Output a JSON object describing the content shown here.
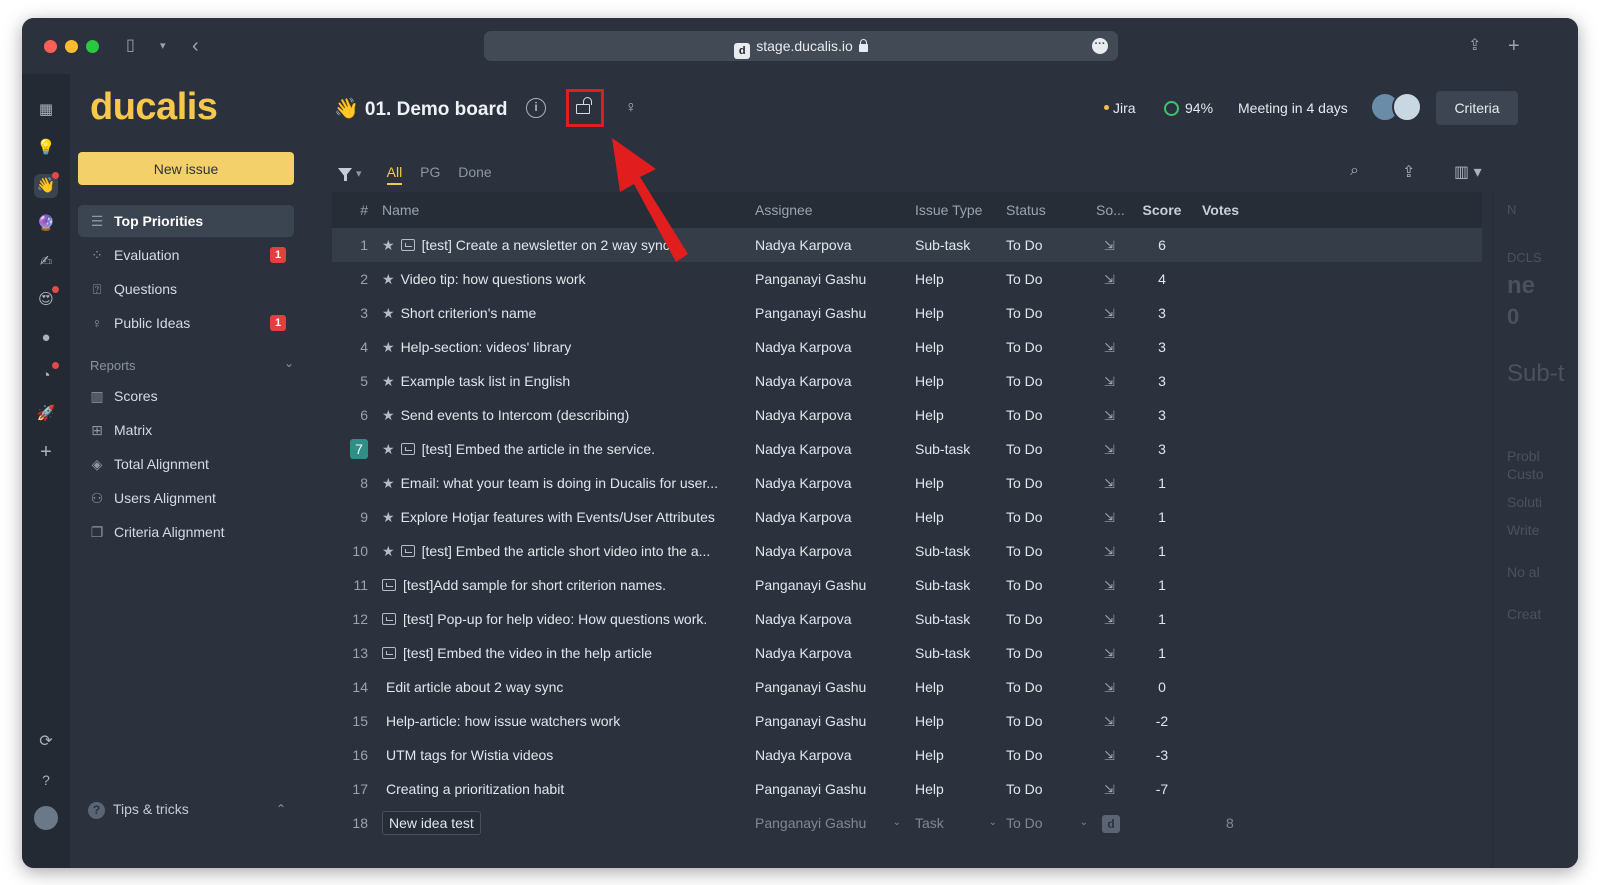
{
  "browser": {
    "url": "stage.ducalis.io",
    "favicon_letter": "d"
  },
  "sidebar": {
    "logo": "ducalis",
    "new_issue_label": "New issue",
    "items": [
      {
        "label": "Top Priorities",
        "icon": "list-icon"
      },
      {
        "label": "Evaluation",
        "icon": "evaluation-icon",
        "badge": "1"
      },
      {
        "label": "Questions",
        "icon": "questions-icon"
      },
      {
        "label": "Public Ideas",
        "icon": "bulb-icon",
        "badge": "1"
      }
    ],
    "reports_label": "Reports",
    "reports": [
      {
        "label": "Scores",
        "icon": "columns-icon"
      },
      {
        "label": "Matrix",
        "icon": "grid-icon"
      },
      {
        "label": "Total Alignment",
        "icon": "layers-icon"
      },
      {
        "label": "Users Alignment",
        "icon": "users-icon"
      },
      {
        "label": "Criteria Alignment",
        "icon": "copy-icon"
      }
    ],
    "tips_label": "Tips & tricks"
  },
  "header": {
    "board_title": "01. Demo board",
    "board_emoji": "👋",
    "jira_label": "Jira",
    "progress_label": "94%",
    "meeting_label": "Meeting in 4 days",
    "criteria_label": "Criteria"
  },
  "filters": {
    "tabs": [
      "All",
      "PG",
      "Done"
    ],
    "active_tab": "All"
  },
  "table": {
    "columns": {
      "num": "#",
      "name": "Name",
      "assignee": "Assignee",
      "issue_type": "Issue Type",
      "status": "Status",
      "so": "So...",
      "score": "Score",
      "votes": "Votes"
    },
    "rows": [
      {
        "num": "1",
        "star": true,
        "subtask_icon": true,
        "name": "[test] Create a newsletter on 2 way sync",
        "assignee": "Nadya Karpova",
        "type": "Sub-task",
        "status": "To Do",
        "score": "6"
      },
      {
        "num": "2",
        "star": true,
        "subtask_icon": false,
        "name": "Video tip: how questions work",
        "assignee": "Panganayi Gashu",
        "type": "Help",
        "status": "To Do",
        "score": "4"
      },
      {
        "num": "3",
        "star": true,
        "subtask_icon": false,
        "name": "Short criterion's name",
        "assignee": "Panganayi Gashu",
        "type": "Help",
        "status": "To Do",
        "score": "3"
      },
      {
        "num": "4",
        "star": true,
        "subtask_icon": false,
        "name": "Help-section: videos' library",
        "assignee": "Nadya Karpova",
        "type": "Help",
        "status": "To Do",
        "score": "3"
      },
      {
        "num": "5",
        "star": true,
        "subtask_icon": false,
        "name": "Example task list in English",
        "assignee": "Nadya Karpova",
        "type": "Help",
        "status": "To Do",
        "score": "3"
      },
      {
        "num": "6",
        "star": true,
        "subtask_icon": false,
        "name": "Send events to Intercom (describing)",
        "assignee": "Nadya Karpova",
        "type": "Help",
        "status": "To Do",
        "score": "3"
      },
      {
        "num": "7",
        "star": true,
        "subtask_icon": true,
        "name": "[test] Embed the article in the service.",
        "assignee": "Nadya Karpova",
        "type": "Sub-task",
        "status": "To Do",
        "score": "3"
      },
      {
        "num": "8",
        "star": true,
        "subtask_icon": false,
        "name": "Email: what your team is doing in Ducalis for user...",
        "assignee": "Nadya Karpova",
        "type": "Help",
        "status": "To Do",
        "score": "1"
      },
      {
        "num": "9",
        "star": true,
        "subtask_icon": false,
        "name": "Explore Hotjar features with Events/User Attributes",
        "assignee": "Nadya Karpova",
        "type": "Help",
        "status": "To Do",
        "score": "1"
      },
      {
        "num": "10",
        "star": true,
        "subtask_icon": true,
        "name": "[test] Embed the article short video into the a...",
        "assignee": "Nadya Karpova",
        "type": "Sub-task",
        "status": "To Do",
        "score": "1"
      },
      {
        "num": "11",
        "star": false,
        "subtask_icon": true,
        "name": "[test]Add sample for short criterion names.",
        "assignee": "Panganayi Gashu",
        "type": "Sub-task",
        "status": "To Do",
        "score": "1"
      },
      {
        "num": "12",
        "star": false,
        "subtask_icon": true,
        "name": "[test] Pop-up for help video: How questions work.",
        "assignee": "Nadya Karpova",
        "type": "Sub-task",
        "status": "To Do",
        "score": "1"
      },
      {
        "num": "13",
        "star": false,
        "subtask_icon": true,
        "name": "[test] Embed the video in the help article",
        "assignee": "Nadya Karpova",
        "type": "Sub-task",
        "status": "To Do",
        "score": "1"
      },
      {
        "num": "14",
        "star": false,
        "subtask_icon": false,
        "name": "Edit article about 2 way sync",
        "assignee": "Panganayi Gashu",
        "type": "Help",
        "status": "To Do",
        "score": "0"
      },
      {
        "num": "15",
        "star": false,
        "subtask_icon": false,
        "name": "Help-article: how issue watchers work",
        "assignee": "Panganayi Gashu",
        "type": "Help",
        "status": "To Do",
        "score": "-2"
      },
      {
        "num": "16",
        "star": false,
        "subtask_icon": false,
        "name": "UTM tags for Wistia videos",
        "assignee": "Nadya Karpova",
        "type": "Help",
        "status": "To Do",
        "score": "-3"
      },
      {
        "num": "17",
        "star": false,
        "subtask_icon": false,
        "name": "Creating a prioritization habit",
        "assignee": "Panganayi Gashu",
        "type": "Help",
        "status": "To Do",
        "score": "-7"
      }
    ],
    "new_row": {
      "num": "18",
      "name": "New idea test",
      "assignee": "Panganayi Gashu",
      "type": "Task",
      "status": "To Do",
      "so_badge": "d",
      "votes": "8"
    }
  },
  "side_panel_ghost": [
    "N",
    "DCLS",
    "ne",
    "0",
    "Sub-t",
    "Probl",
    "Custo",
    "Soluti",
    "Write",
    "No al",
    "Creat"
  ],
  "colors": {
    "accent": "#f4d06a",
    "badge": "#e53e3e",
    "highlight_box": "#e21d1d",
    "progress": "#3ec26b"
  }
}
